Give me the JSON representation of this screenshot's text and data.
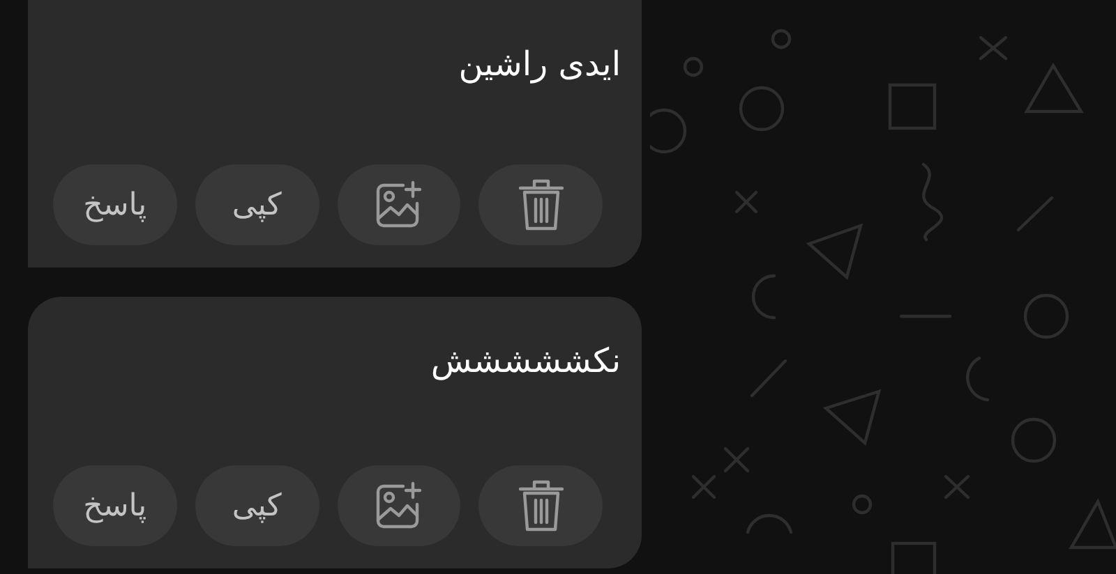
{
  "messages": [
    {
      "text": "ایدی راشین",
      "actions": [
        {
          "kind": "delete"
        },
        {
          "kind": "add-image"
        },
        {
          "kind": "copy",
          "label": "کپی"
        },
        {
          "kind": "reply",
          "label": "پاسخ"
        }
      ]
    },
    {
      "text": "نکششششش",
      "actions": [
        {
          "kind": "delete"
        },
        {
          "kind": "add-image"
        },
        {
          "kind": "copy",
          "label": "کپی"
        },
        {
          "kind": "reply",
          "label": "پاسخ"
        }
      ]
    }
  ]
}
